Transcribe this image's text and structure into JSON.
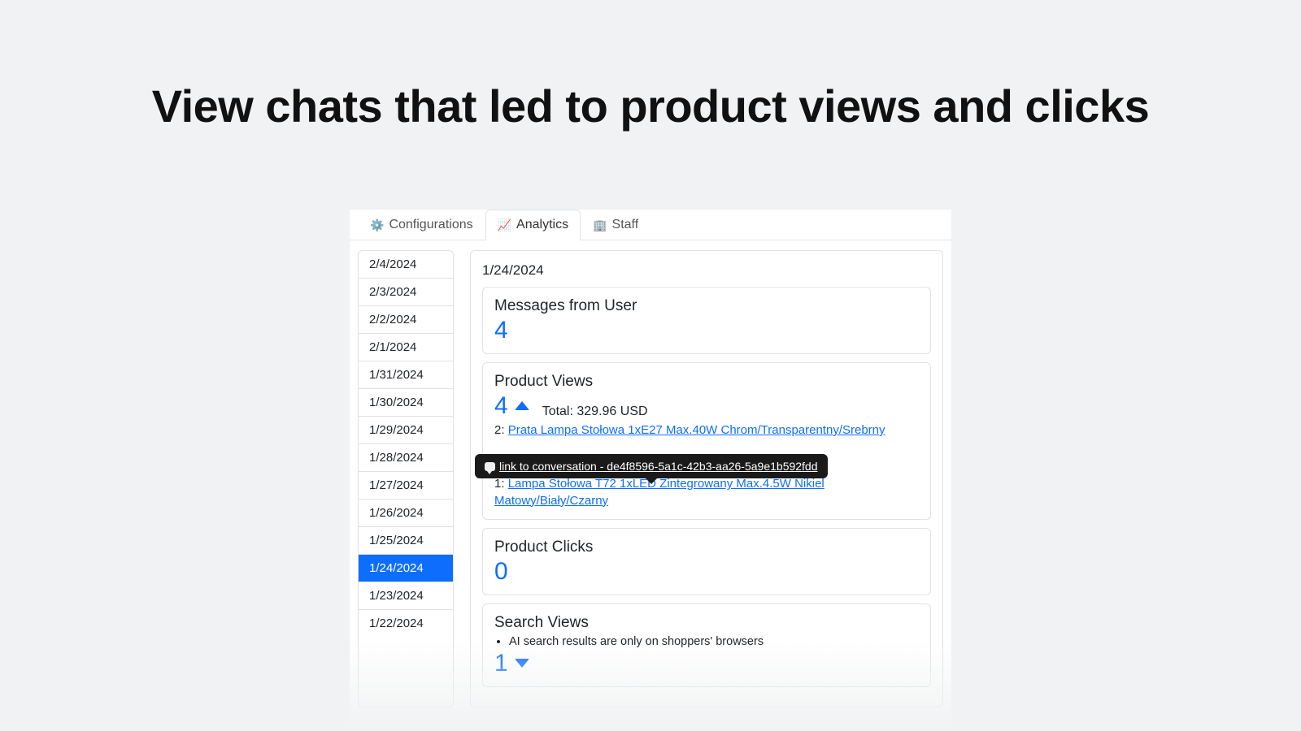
{
  "headline": "View chats that led to product views and clicks",
  "tabs": {
    "configurations": {
      "icon": "⚙️",
      "label": "Configurations"
    },
    "analytics": {
      "icon": "📈",
      "label": "Analytics"
    },
    "staff": {
      "icon": "🏢",
      "label": "Staff"
    }
  },
  "dates": [
    "2/4/2024",
    "2/3/2024",
    "2/2/2024",
    "2/1/2024",
    "1/31/2024",
    "1/30/2024",
    "1/29/2024",
    "1/28/2024",
    "1/27/2024",
    "1/26/2024",
    "1/25/2024",
    "1/24/2024",
    "1/23/2024",
    "1/22/2024"
  ],
  "selected_date_index": 11,
  "detail": {
    "date": "1/24/2024",
    "messages": {
      "title": "Messages from User",
      "value": "4"
    },
    "product_views": {
      "title": "Product Views",
      "value": "4",
      "total": "Total: 329.96 USD",
      "items": [
        {
          "qty": "2",
          "name": "Prata Lampa Stołowa 1xE27 Max.40W Chrom/Transparentny/Srebrny"
        },
        {
          "qty": "1",
          "name": "Lampa Stołowa T72 1xLED Zintegrowany Max.4.5W Nikiel Matowy/Biały/Czarny"
        }
      ]
    },
    "product_clicks": {
      "title": "Product Clicks",
      "value": "0"
    },
    "search_views": {
      "title": "Search Views",
      "note": "AI search results are only on shoppers' browsers",
      "value": "1"
    },
    "tooltip": "link to conversation - de4f8596-5a1c-42b3-aa26-5a9e1b592fdd"
  }
}
